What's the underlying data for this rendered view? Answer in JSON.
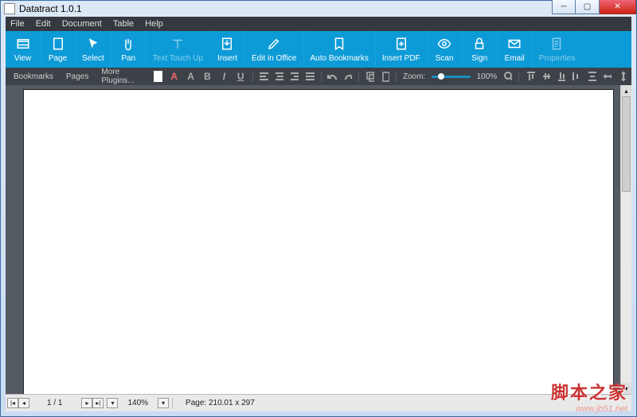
{
  "window": {
    "title": "Datatract 1.0.1"
  },
  "controls": {
    "min": "─",
    "max": "▢",
    "close": "✕"
  },
  "menu": {
    "file": "File",
    "edit": "Edit",
    "document": "Document",
    "table": "Table",
    "help": "Help"
  },
  "ribbon": {
    "view": "View",
    "page": "Page",
    "select": "Select",
    "pan": "Pan",
    "touchup": "Text Touch Up",
    "insert": "Insert",
    "office": "Edit in Office",
    "autobook": "Auto Bookmarks",
    "insertpdf": "Insert PDF",
    "scan": "Scan",
    "sign": "Sign",
    "email": "Email",
    "props": "Properties"
  },
  "tabs": {
    "bookmarks": "Bookmarks",
    "pages": "Pages",
    "more": "More Plugins..."
  },
  "fmt": {
    "A1": "A",
    "A2": "A",
    "B": "B",
    "I": "I",
    "U": "U"
  },
  "zoom": {
    "label": "Zoom:",
    "value": "100%"
  },
  "status": {
    "first": "|◂",
    "prev": "◂",
    "next": "▸",
    "last": "▸|",
    "down": "▾",
    "pages": "1 / 1",
    "zoom": "140%",
    "page_dim": "Page: 210.01 x 297"
  },
  "scroll": {
    "up": "▴",
    "down": "▾"
  },
  "watermark": {
    "cn": "脚本之家",
    "url": "www.jb51.net"
  }
}
